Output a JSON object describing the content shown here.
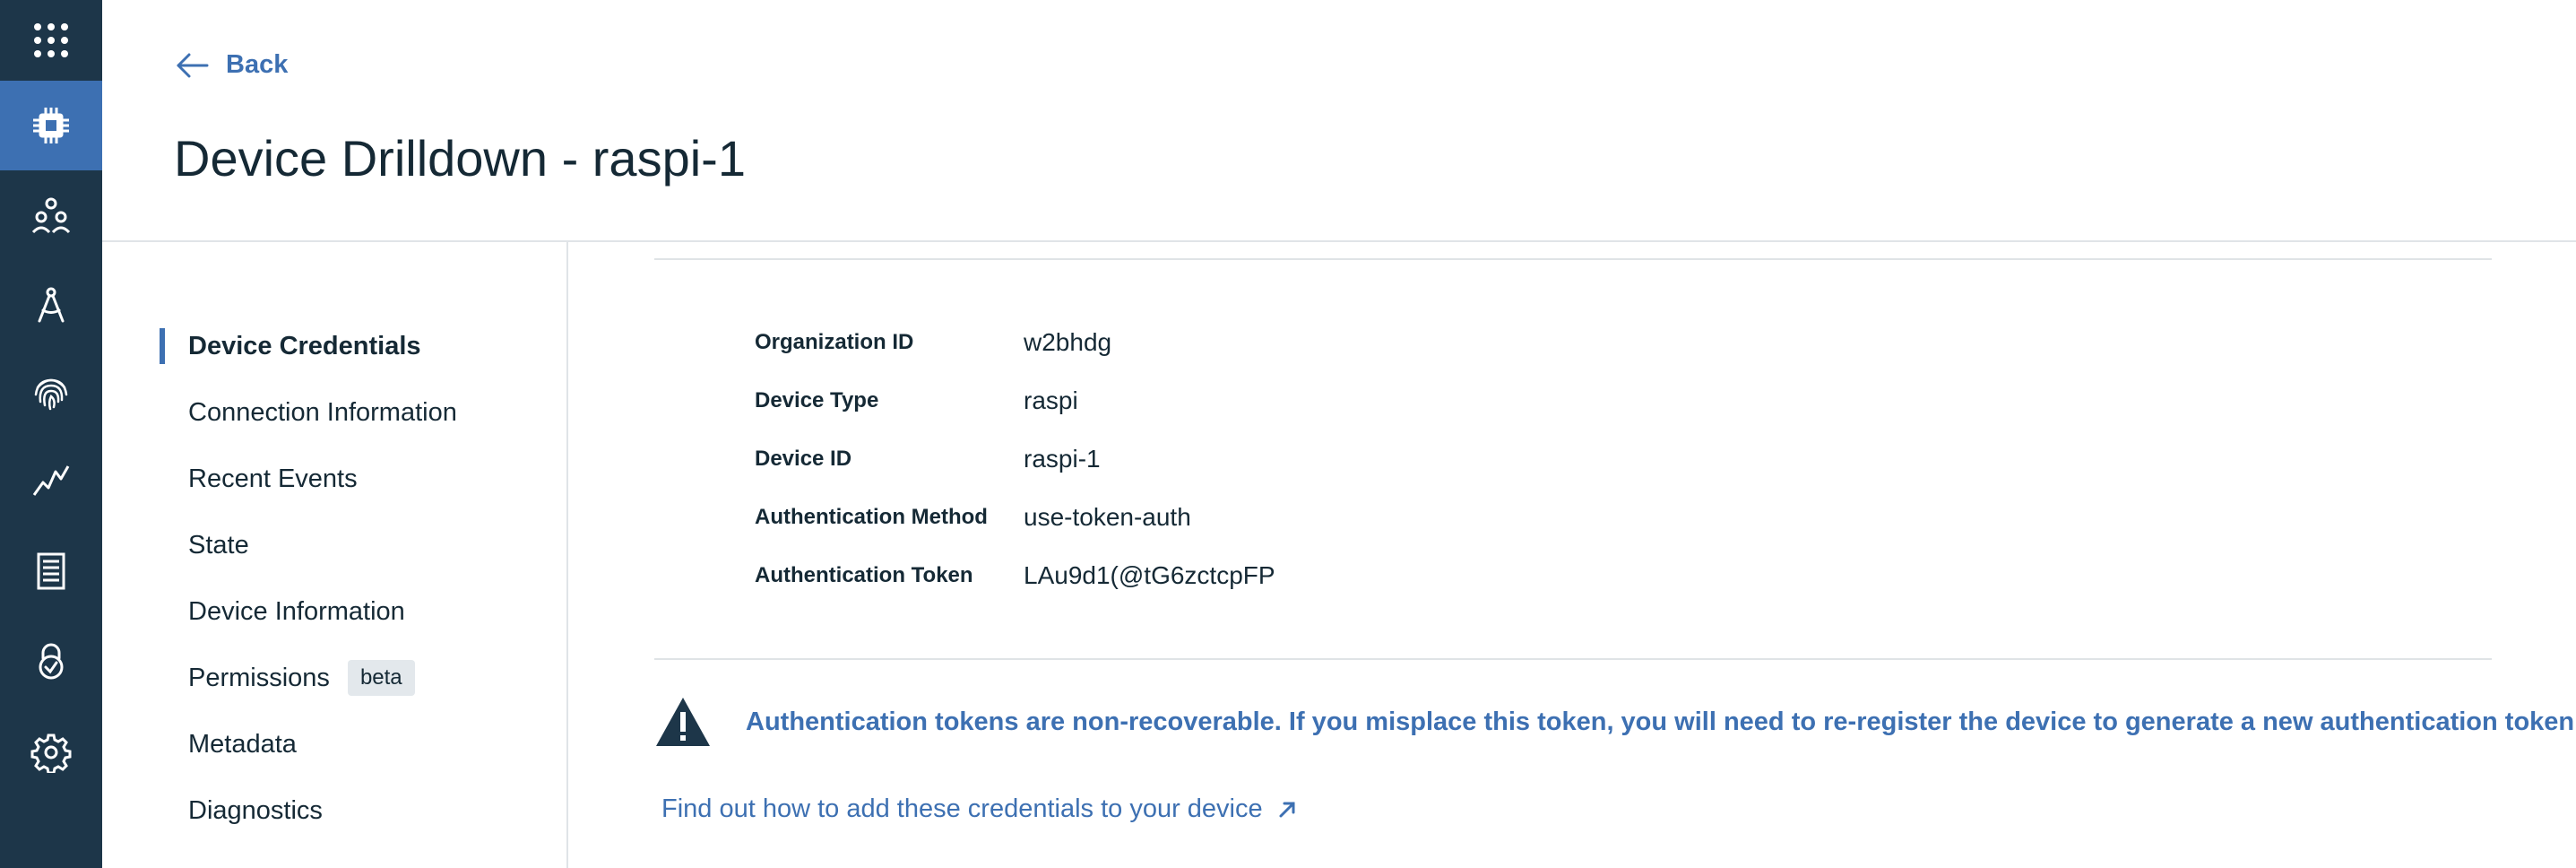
{
  "rail": {
    "items": [
      {
        "icon": "app-switcher-icon"
      },
      {
        "icon": "devices-chip-icon",
        "active": true
      },
      {
        "icon": "members-icon"
      },
      {
        "icon": "compass-icon"
      },
      {
        "icon": "fingerprint-icon"
      },
      {
        "icon": "usage-chart-icon"
      },
      {
        "icon": "logs-document-icon"
      },
      {
        "icon": "security-lock-icon"
      },
      {
        "icon": "settings-gear-icon"
      }
    ]
  },
  "header": {
    "back_label": "Back",
    "title": "Device Drilldown - raspi-1"
  },
  "section_nav": {
    "items": [
      {
        "label": "Device Credentials",
        "active": true
      },
      {
        "label": "Connection Information"
      },
      {
        "label": "Recent Events"
      },
      {
        "label": "State"
      },
      {
        "label": "Device Information"
      },
      {
        "label": "Permissions",
        "tag": "beta"
      },
      {
        "label": "Metadata"
      },
      {
        "label": "Diagnostics"
      }
    ]
  },
  "credentials": {
    "rows": [
      {
        "label": "Organization ID",
        "value": "w2bhdg"
      },
      {
        "label": "Device Type",
        "value": "raspi"
      },
      {
        "label": "Device ID",
        "value": "raspi-1"
      },
      {
        "label": "Authentication Method",
        "value": "use-token-auth"
      },
      {
        "label": "Authentication Token",
        "value": "LAu9d1(@tG6zctcpFP"
      }
    ]
  },
  "warning": {
    "text": "Authentication tokens are non-recoverable. If you misplace this token, you will need to re-register the device to generate a new authentication token."
  },
  "help_link": {
    "label": "Find out how to add these credentials to your device"
  },
  "colors": {
    "rail_bg": "#1d3649",
    "accent": "#3d70b2",
    "text": "#152935"
  }
}
